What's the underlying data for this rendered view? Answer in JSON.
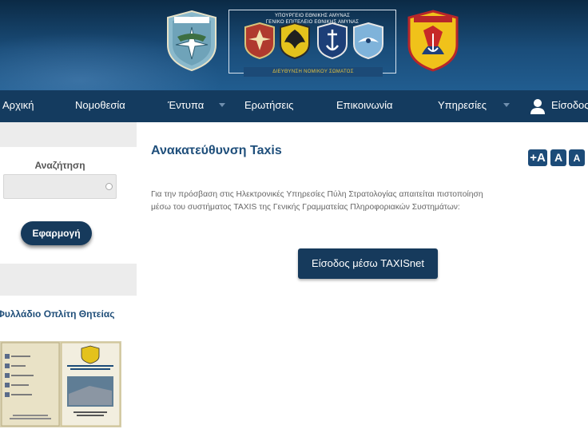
{
  "header": {
    "ministry_line1": "ΥΠΟΥΡΓΕΙΟ ΕΘΝΙΚΗΣ ΑΜΥΝΑΣ",
    "ministry_line2": "ΓΕΝΙΚΟ ΕΠΙΤΕΛΕΙΟ ΕΘΝΙΚΗΣ ΑΜΥΝΑΣ",
    "ministry_footer": "ΔΙΕΥΘΥΝΣΗ ΝΟΜΙΚΟΥ ΣΩΜΑΤΟΣ"
  },
  "nav": {
    "items": [
      {
        "label": "Αρχική"
      },
      {
        "label": "Νομοθεσία"
      },
      {
        "label": "Έντυπα"
      },
      {
        "label": "Ερωτήσεις"
      },
      {
        "label": "Επικοινωνία"
      },
      {
        "label": "Υπηρεσίες"
      },
      {
        "label": "Είσοδος"
      }
    ]
  },
  "sidebar": {
    "search_title": "Αναζήτηση",
    "search_placeholder": "",
    "apply_label": "Εφαρμογή",
    "booklet_title": "Φυλλάδιο Οπλίτη Θητείας"
  },
  "main": {
    "title": "Ανακατεύθυνση Taxis",
    "font_buttons": [
      "+A",
      "A",
      "A"
    ],
    "text_line1": "Για την πρόσβαση στις Ηλεκτρονικές Υπηρεσίες Πύλη Στρατολογίας απαιτείται πιστοποίηση",
    "text_line2": "μέσω του συστήματος TAXIS της Γενικής Γραμματείας Πληροφοριακών Συστημάτων:",
    "taxis_button": "Είσοδος μέσω TAXISnet"
  },
  "colors": {
    "header_bg": "#1a4d7a",
    "nav_bg": "#143b5f",
    "button_bg": "#163a5c",
    "title_color": "#1f4f7b"
  }
}
